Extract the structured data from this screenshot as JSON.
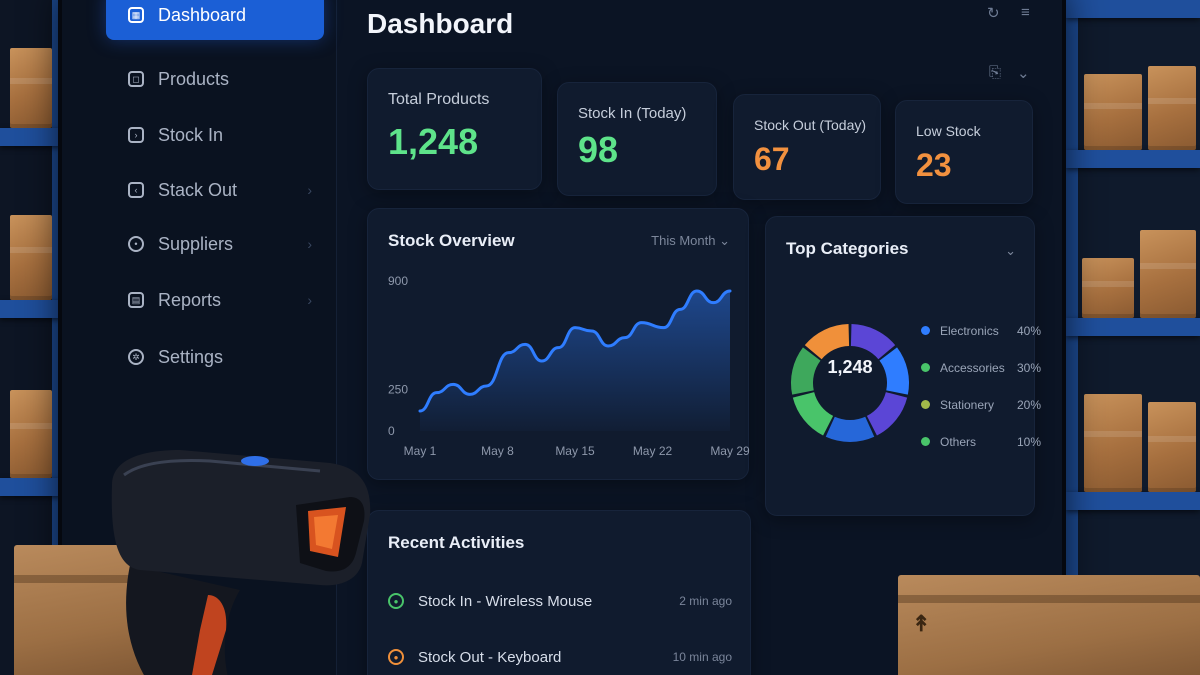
{
  "sidebar": {
    "items": [
      {
        "label": "Dashboard",
        "icon": "dashboard-icon",
        "active": true
      },
      {
        "label": "Products",
        "icon": "box-icon"
      },
      {
        "label": "Stock In",
        "icon": "arrow-in-icon"
      },
      {
        "label": "Stack Out",
        "icon": "arrow-out-icon"
      },
      {
        "label": "Suppliers",
        "icon": "truck-icon"
      },
      {
        "label": "Reports",
        "icon": "report-icon"
      },
      {
        "label": "Settings",
        "icon": "gear-icon"
      }
    ]
  },
  "header": {
    "title": "Dashboard"
  },
  "stats": [
    {
      "label": "Total Products",
      "value": "1,248",
      "color": "#5ee38a"
    },
    {
      "label": "Stock In (Today)",
      "value": "98",
      "color": "#5ee38a"
    },
    {
      "label": "Stock Out (Today)",
      "value": "67",
      "color": "#f2913f"
    },
    {
      "label": "Low Stock",
      "value": "23",
      "color": "#f2913f"
    }
  ],
  "overview": {
    "title": "Stock Overview",
    "range": "This Month"
  },
  "chart_data": {
    "type": "area",
    "title": "Stock Overview",
    "x_ticks": [
      "May 1",
      "May 8",
      "May 15",
      "May 22",
      "May 29"
    ],
    "y_ticks": [
      "900",
      "250",
      "0"
    ],
    "x": [
      0,
      1.5,
      3,
      4.5,
      6,
      8,
      9.5,
      11,
      12.5,
      14,
      15.5,
      17,
      18.5,
      20,
      22,
      23.5,
      25,
      26.5,
      28
    ],
    "values": [
      120,
      230,
      280,
      220,
      270,
      470,
      520,
      420,
      500,
      620,
      600,
      510,
      560,
      650,
      620,
      730,
      840,
      770,
      840
    ],
    "series_color": "#2f7dff",
    "grid": false
  },
  "categories_card": {
    "title": "Top Categories",
    "center_value": "1,248",
    "slices": [
      {
        "name": "Electronics",
        "pct": "40%",
        "color": "#2f7dff"
      },
      {
        "name": "Accessories",
        "pct": "30%",
        "color": "#49c46a"
      },
      {
        "name": "Stationery",
        "pct": "20%",
        "color": "#a2b94a"
      },
      {
        "name": "Others",
        "pct": "10%",
        "color": "#49c46a"
      }
    ],
    "ring_colors": [
      "#5b46d6",
      "#2f7dff",
      "#5b46d6",
      "#2667d9",
      "#49c46a",
      "#3ea85c",
      "#f0903a"
    ]
  },
  "activities": {
    "title": "Recent Activities",
    "items": [
      {
        "text": "Stock In - Wireless Mouse",
        "time": "2 min ago",
        "color": "#49c46a"
      },
      {
        "text": "Stock Out - Keyboard",
        "time": "10 min ago",
        "color": "#f0903a"
      }
    ]
  }
}
